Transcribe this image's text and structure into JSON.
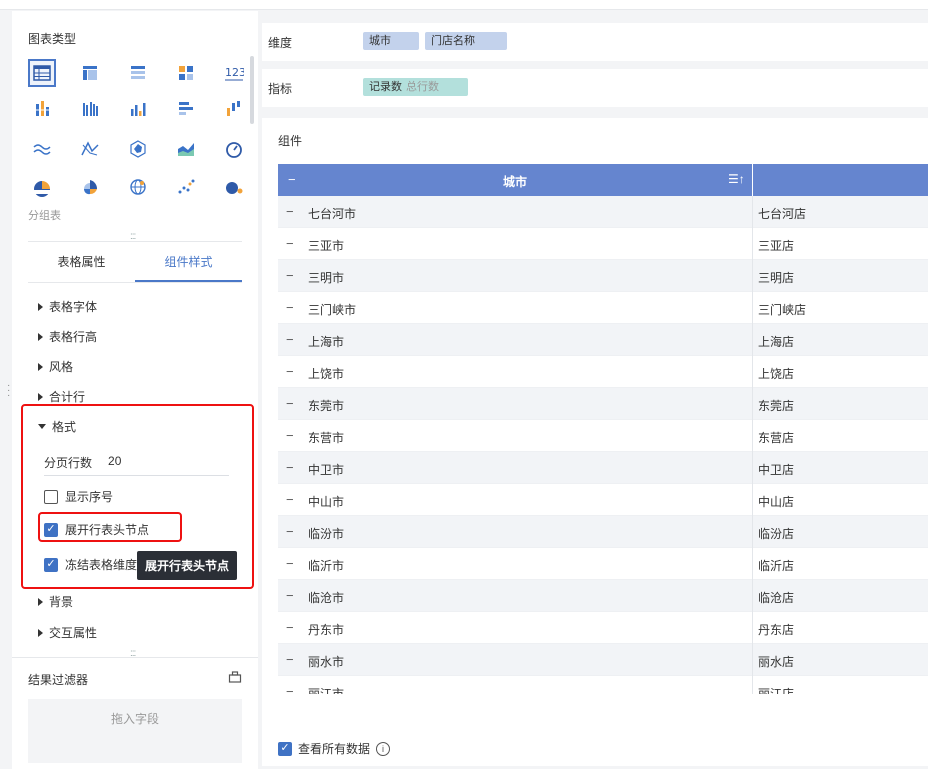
{
  "left_panel": {
    "chart_type_title": "图表类型",
    "group_label": "分组表",
    "tabs": [
      "表格属性",
      "组件样式"
    ],
    "sections": [
      "表格字体",
      "表格行高",
      "风格",
      "合计行",
      "格式",
      "背景",
      "交互属性"
    ],
    "format": {
      "page_rows_label": "分页行数",
      "page_rows_value": "20",
      "show_index_label": "显示序号",
      "show_index_checked": false,
      "expand_header_label": "展开行表头节点",
      "expand_header_checked": true,
      "freeze_label": "冻结表格维度",
      "freeze_checked": true
    },
    "tooltip": "展开行表头节点",
    "filter_title": "结果过滤器",
    "dropzone_text": "拖入字段"
  },
  "dimension": {
    "label": "维度",
    "fields": [
      "城市",
      "门店名称"
    ]
  },
  "metric": {
    "label": "指标",
    "field": "记录数",
    "field_sub": "总行数"
  },
  "component": {
    "title": "组件",
    "column_header": "城市",
    "rows": [
      {
        "city": "七台河市",
        "store": "七台河店"
      },
      {
        "city": "三亚市",
        "store": "三亚店"
      },
      {
        "city": "三明市",
        "store": "三明店"
      },
      {
        "city": "三门峡市",
        "store": "三门峡店"
      },
      {
        "city": "上海市",
        "store": "上海店"
      },
      {
        "city": "上饶市",
        "store": "上饶店"
      },
      {
        "city": "东莞市",
        "store": "东莞店"
      },
      {
        "city": "东营市",
        "store": "东营店"
      },
      {
        "city": "中卫市",
        "store": "中卫店"
      },
      {
        "city": "中山市",
        "store": "中山店"
      },
      {
        "city": "临汾市",
        "store": "临汾店"
      },
      {
        "city": "临沂市",
        "store": "临沂店"
      },
      {
        "city": "临沧市",
        "store": "临沧店"
      },
      {
        "city": "丹东市",
        "store": "丹东店"
      },
      {
        "city": "丽水市",
        "store": "丽水店"
      },
      {
        "city": "丽江市",
        "store": "丽江店"
      }
    ],
    "view_all_label": "查看所有数据"
  },
  "colors": {
    "accent": "#4a78c8",
    "header_bg": "#6585cf",
    "highlight": "#ee1111"
  }
}
